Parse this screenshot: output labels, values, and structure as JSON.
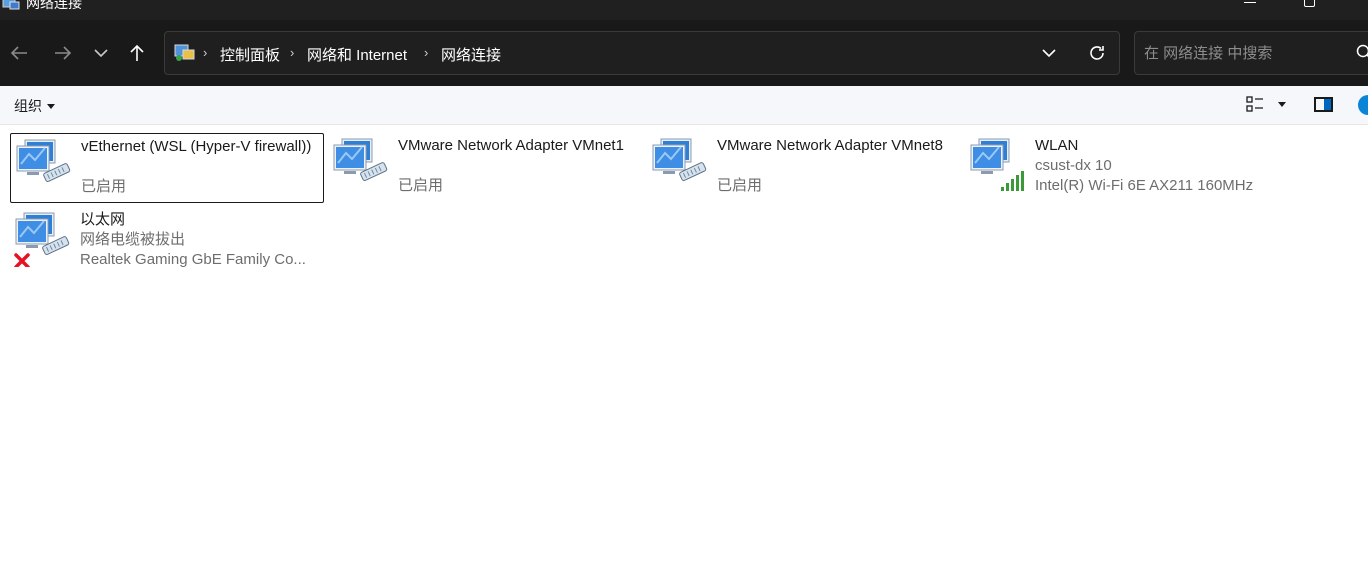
{
  "window": {
    "title": "网络连接",
    "icon": "network-connections-icon"
  },
  "nav": {
    "back_icon": "arrow-left-icon",
    "forward_icon": "arrow-right-icon",
    "recent_icon": "chevron-down-icon",
    "up_icon": "arrow-up-icon"
  },
  "address": {
    "crumbs": [
      "控制面板",
      "网络和 Internet",
      "网络连接"
    ],
    "separator": "›"
  },
  "search": {
    "placeholder": "在 网络连接 中搜索"
  },
  "commandbar": {
    "organize_label": "组织"
  },
  "connections": [
    {
      "name": "vEthernet (WSL (Hyper-V firewall))",
      "status": "已启用",
      "device": "",
      "type": "ethernet",
      "selected": true
    },
    {
      "name": "VMware Network Adapter VMnet1",
      "status": "已启用",
      "device": "",
      "type": "ethernet",
      "selected": false
    },
    {
      "name": "VMware Network Adapter VMnet8",
      "status": "已启用",
      "device": "",
      "type": "ethernet",
      "selected": false
    },
    {
      "name": "WLAN",
      "status": "csust-dx 10",
      "device": "Intel(R) Wi-Fi 6E AX211 160MHz",
      "type": "wifi",
      "selected": false
    },
    {
      "name": "以太网",
      "status": "网络电缆被拔出",
      "device": "Realtek Gaming GbE Family Co...",
      "type": "ethernet-disconnected",
      "selected": false
    }
  ],
  "colors": {
    "titlebar_bg": "#202020",
    "navbar_bg": "#191919",
    "commandbar_bg": "#f5f7fb",
    "accent": "#0067c0",
    "wifi_signal": "#3a9a3a",
    "error_x": "#e81123"
  }
}
